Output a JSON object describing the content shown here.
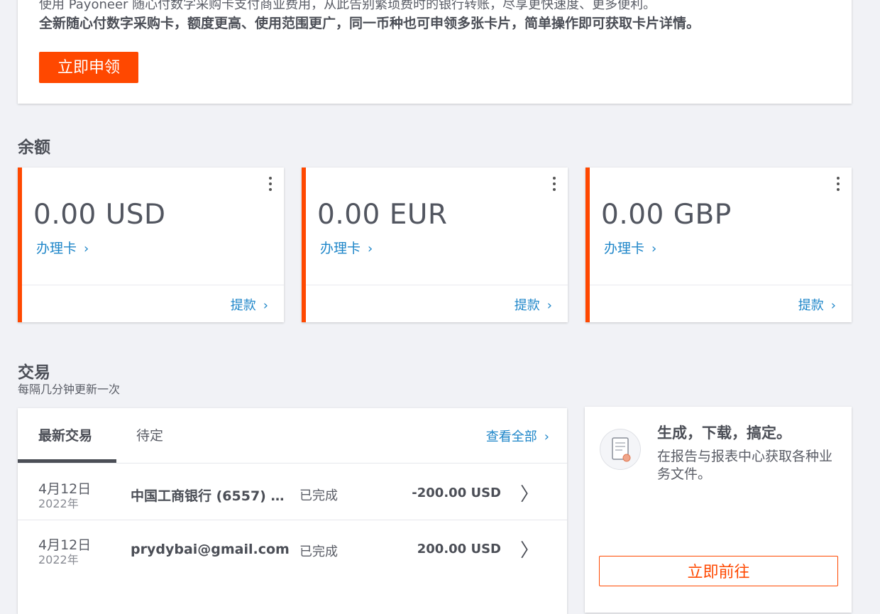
{
  "promo": {
    "line1": "使用 Payoneer 随心付数字采购卡支付商业费用，从此告别繁琐费时的银行转账，尽享更快速度、更多便利。",
    "line2": "全新随心付数字采购卡，额度更高、使用范围更广，同一币种也可申领多张卡片，简单操作即可获取卡片详情。",
    "apply_button": "立即申领"
  },
  "balance": {
    "title": "余额",
    "cards": [
      {
        "amount": "0.00 USD",
        "card_link": "办理卡",
        "withdraw": "提款"
      },
      {
        "amount": "0.00 EUR",
        "card_link": "办理卡",
        "withdraw": "提款"
      },
      {
        "amount": "0.00 GBP",
        "card_link": "办理卡",
        "withdraw": "提款"
      }
    ]
  },
  "transactions": {
    "title": "交易",
    "subtitle": "每隔几分钟更新一次",
    "tabs": [
      "最新交易",
      "待定"
    ],
    "view_all": "查看全部",
    "rows": [
      {
        "date": "4月12日",
        "year": "2022年",
        "name": "中国工商银行 (6557) …",
        "status": "已完成",
        "amount": "-200.00 USD"
      },
      {
        "date": "4月12日",
        "year": "2022年",
        "name": "prydybai@gmail.com",
        "status": "已完成",
        "amount": "200.00 USD"
      }
    ]
  },
  "reports": {
    "title": "生成，下载，搞定。",
    "description": "在报告与报表中心获取各种业务文件。",
    "button": "立即前往"
  },
  "colors": {
    "accent": "#ff4800",
    "link": "#1e86c9",
    "background": "#f1f2f6"
  }
}
